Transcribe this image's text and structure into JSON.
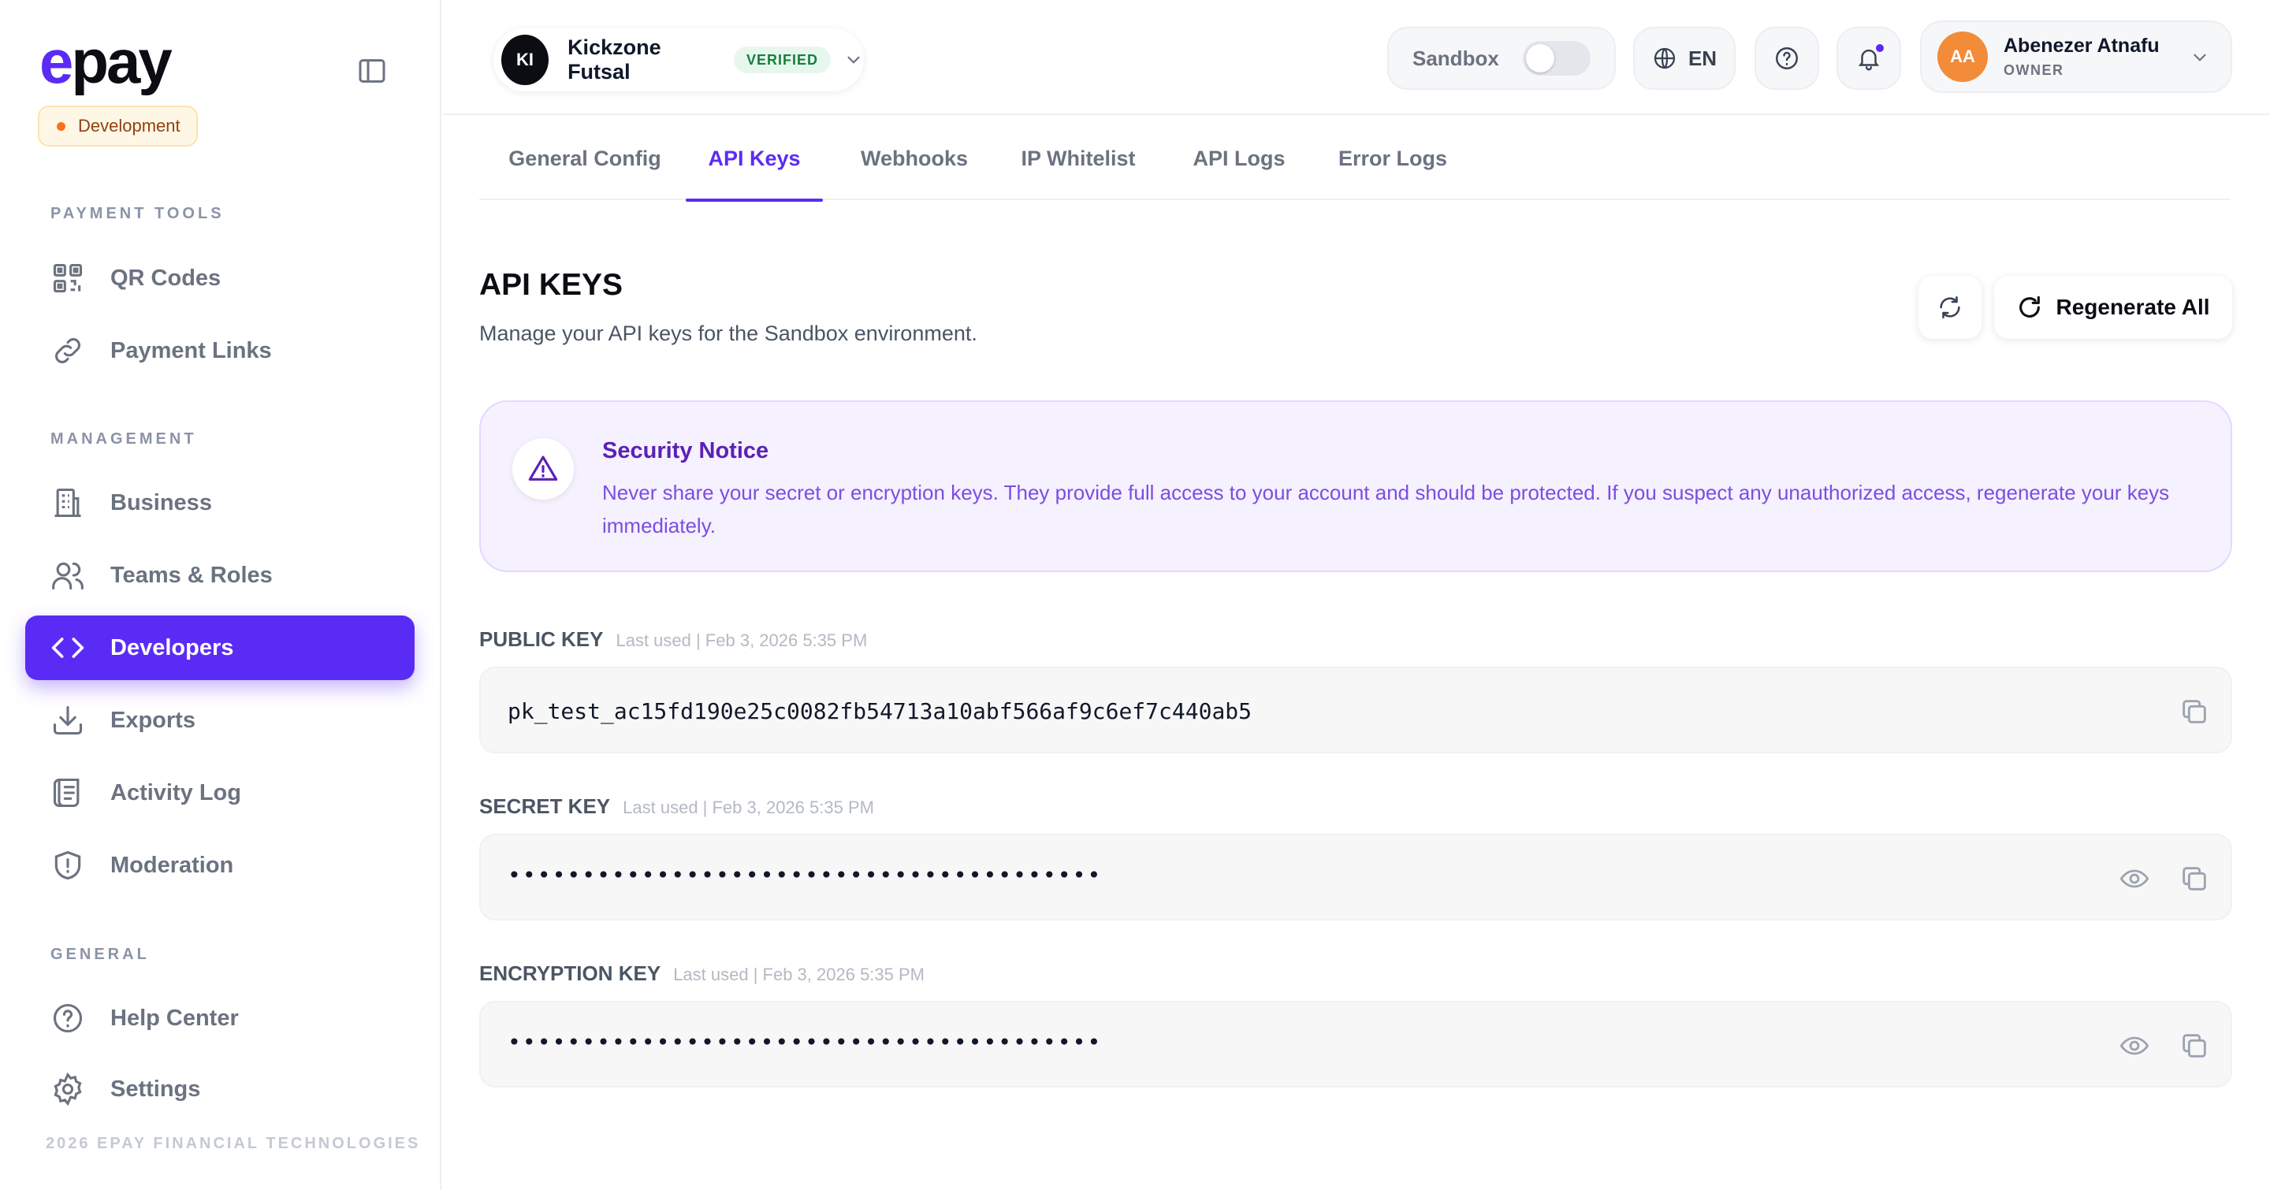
{
  "brand": {
    "logo_e": "e",
    "logo_rest": "pay",
    "env_badge": "Development"
  },
  "sidebar": {
    "sections": [
      {
        "title": "PAYMENT TOOLS"
      },
      {
        "title": "MANAGEMENT"
      },
      {
        "title": "GENERAL"
      }
    ],
    "items": [
      {
        "label": "QR Codes",
        "icon": "qr-code-icon"
      },
      {
        "label": "Payment Links",
        "icon": "link-icon"
      },
      {
        "label": "Business",
        "icon": "building-icon"
      },
      {
        "label": "Teams & Roles",
        "icon": "users-icon"
      },
      {
        "label": "Developers",
        "icon": "code-icon",
        "active": true
      },
      {
        "label": "Exports",
        "icon": "download-icon"
      },
      {
        "label": "Activity Log",
        "icon": "scroll-icon"
      },
      {
        "label": "Moderation",
        "icon": "shield-icon"
      },
      {
        "label": "Help Center",
        "icon": "help-circle-icon"
      },
      {
        "label": "Settings",
        "icon": "gear-icon"
      }
    ],
    "copyright": "2026 EPAY FINANCIAL TECHNOLOGIES"
  },
  "header": {
    "business": {
      "initials": "KI",
      "name": "Kickzone Futsal",
      "badge": "VERIFIED"
    },
    "sandbox": {
      "label": "Sandbox",
      "enabled": false
    },
    "language": "EN",
    "user": {
      "initials": "AA",
      "name": "Abenezer Atnafu",
      "role": "OWNER"
    }
  },
  "tabs": [
    {
      "label": "General Config"
    },
    {
      "label": "API Keys",
      "active": true
    },
    {
      "label": "Webhooks"
    },
    {
      "label": "IP Whitelist"
    },
    {
      "label": "API Logs"
    },
    {
      "label": "Error Logs"
    }
  ],
  "page": {
    "title": "API KEYS",
    "description": "Manage your API keys for the Sandbox environment.",
    "regenerate_label": "Regenerate All"
  },
  "notice": {
    "title": "Security Notice",
    "text": "Never share your secret or encryption keys. They provide full access to your account and should be protected. If you suspect any unauthorized access, regenerate your keys immediately."
  },
  "keys": [
    {
      "label": "PUBLIC KEY",
      "last_used": "Last used | Feb 3, 2026 5:35 PM",
      "value": "pk_test_ac15fd190e25c0082fb54713a10abf566af9c6ef7c440ab5"
    },
    {
      "label": "SECRET KEY",
      "last_used": "Last used | Feb 3, 2026 5:35 PM",
      "value": "••••••••••••••••••••••••••••••••••••••••"
    },
    {
      "label": "ENCRYPTION KEY",
      "last_used": "Last used | Feb 3, 2026 5:35 PM",
      "value": "••••••••••••••••••••••••••••••••••••••••"
    }
  ],
  "colors": {
    "accent": "#5b2bf6",
    "verified": "#15803d",
    "avatar_user": "#f28c38"
  }
}
